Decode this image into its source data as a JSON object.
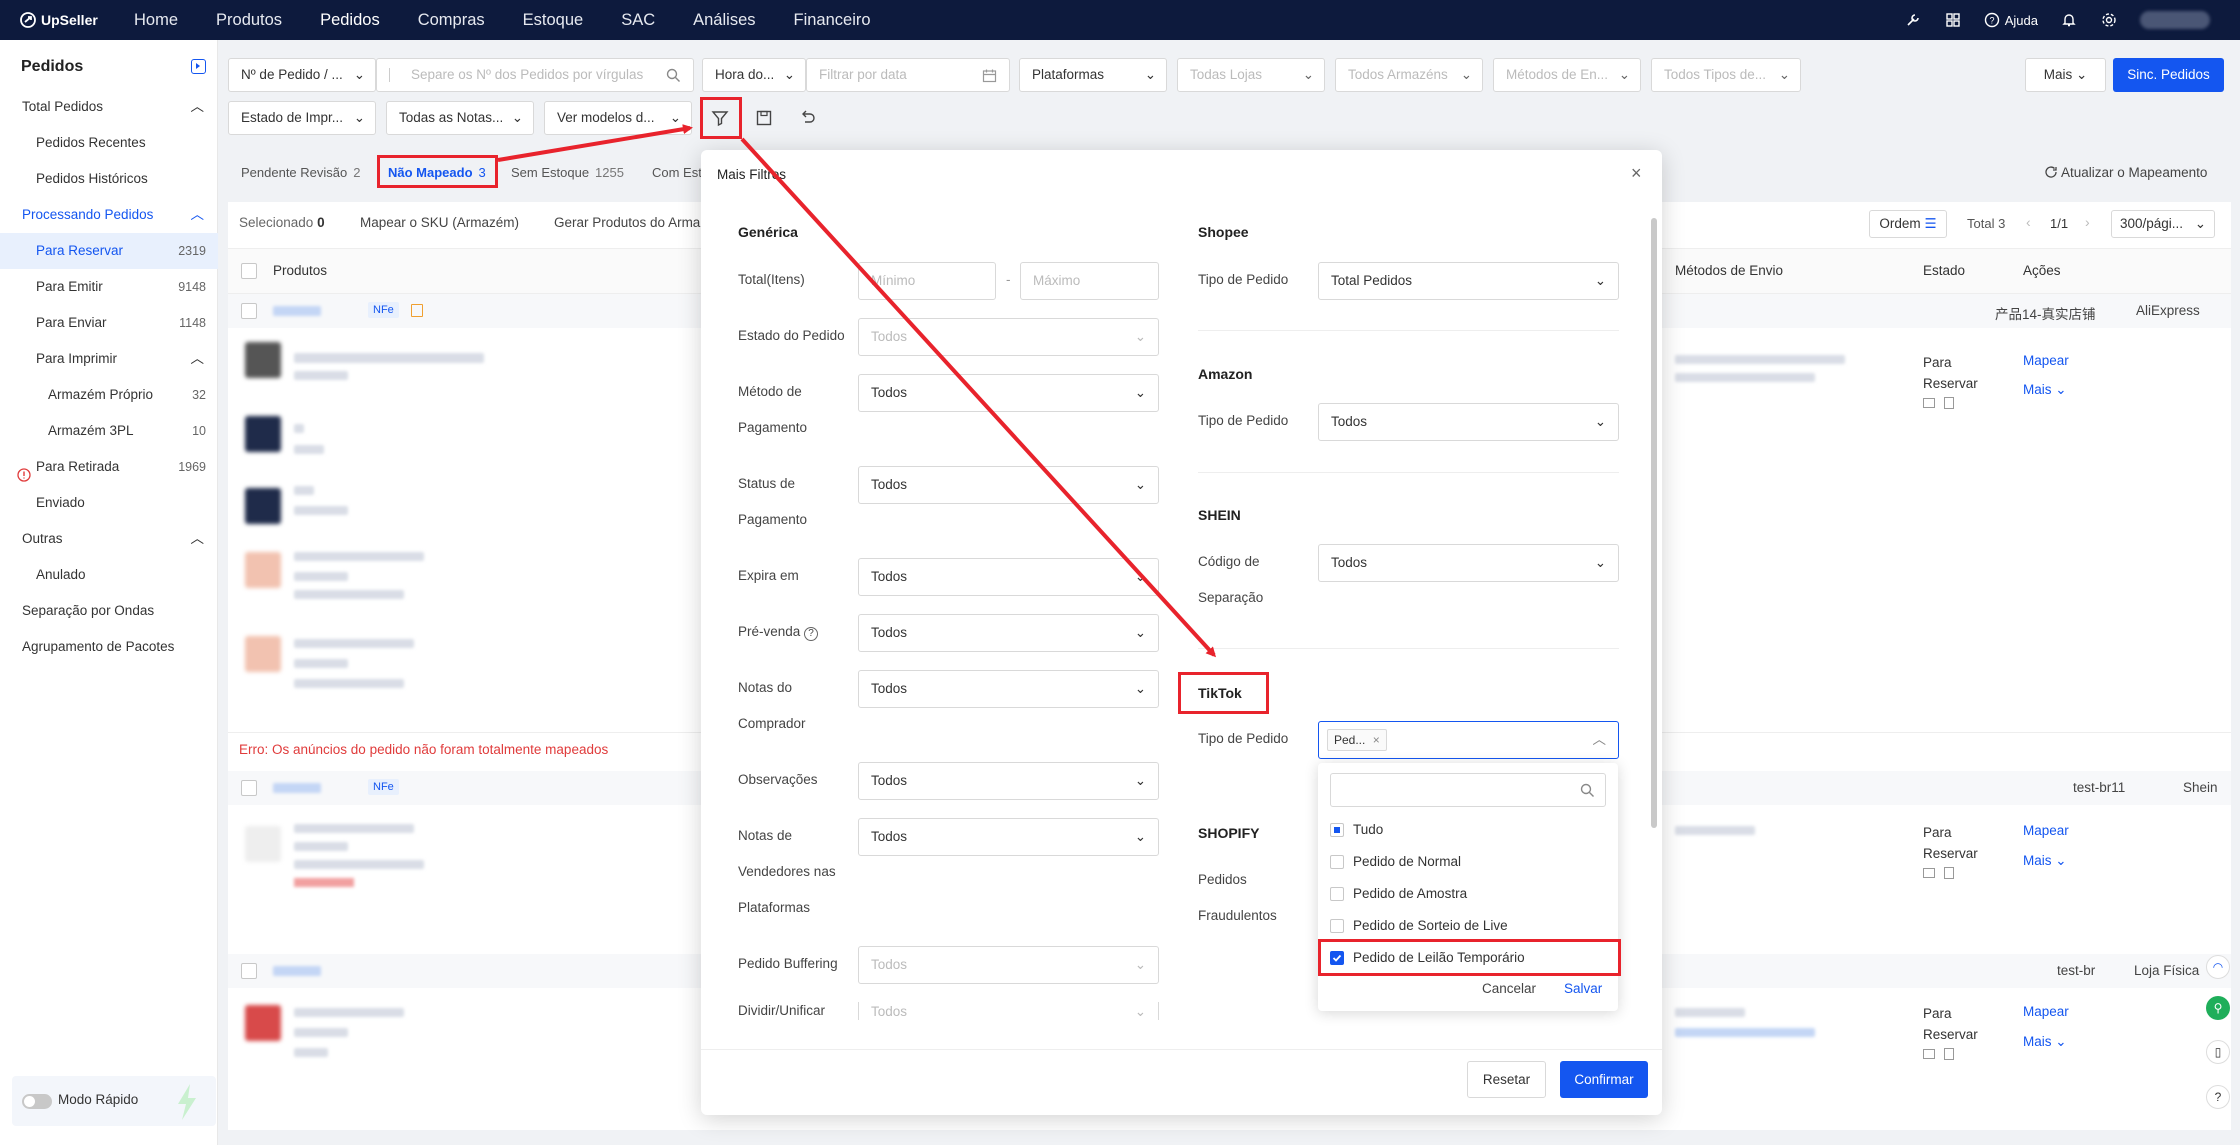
{
  "brand": {
    "name": "UpSeller"
  },
  "nav": {
    "items": [
      "Home",
      "Produtos",
      "Pedidos",
      "Compras",
      "Estoque",
      "SAC",
      "Análises",
      "Financeiro"
    ],
    "active": "Pedidos",
    "help": "Ajuda"
  },
  "sidebar": {
    "title": "Pedidos",
    "items": [
      {
        "label": "Total Pedidos"
      },
      {
        "label": "Pedidos Recentes"
      },
      {
        "label": "Pedidos Históricos"
      },
      {
        "label": "Processando Pedidos"
      },
      {
        "label": "Para Reservar",
        "count": "2319"
      },
      {
        "label": "Para Emitir",
        "count": "9148"
      },
      {
        "label": "Para Enviar",
        "count": "1148"
      },
      {
        "label": "Para Imprimir"
      },
      {
        "label": "Armazém Próprio",
        "count": "32"
      },
      {
        "label": "Armazém 3PL",
        "count": "10"
      },
      {
        "label": "Para Retirada",
        "count": "1969"
      },
      {
        "label": "Enviado"
      },
      {
        "label": "Outras"
      },
      {
        "label": "Anulado"
      },
      {
        "label": "Separação por Ondas"
      },
      {
        "label": "Agrupamento de Pacotes"
      }
    ],
    "quick_mode": "Modo Rápido"
  },
  "filters": {
    "order_no": "Nº de Pedido / ...",
    "search_placeholder": "Separe os Nº dos Pedidos por vírgulas",
    "time": "Hora do...",
    "date_placeholder": "Filtrar por data",
    "platforms": "Plataformas",
    "stores": "Todas Lojas",
    "warehouses": "Todos Armazéns",
    "shipping": "Métodos de En...",
    "types": "Todos Tipos de...",
    "more": "Mais",
    "sync": "Sinc. Pedidos",
    "print_state": "Estado de Impr...",
    "notes": "Todas as Notas...",
    "models": "Ver modelos d..."
  },
  "tabs": [
    {
      "label": "Pendente Revisão",
      "count": "2"
    },
    {
      "label": "Não Mapeado",
      "count": "3"
    },
    {
      "label": "Sem Estoque",
      "count": "1255"
    },
    {
      "label": "Com Est",
      "count": ""
    }
  ],
  "refresh_mapping": "Atualizar o Mapeamento",
  "toolbar": {
    "selected": "Selecionado",
    "selected_count": "0",
    "map_sku": "Mapear o SKU (Armazém)",
    "generate": "Gerar Produtos do Arma",
    "order": "Ordem",
    "total": "Total 3",
    "pages": "1/1",
    "per_page": "300/pági..."
  },
  "table": {
    "headers": {
      "products": "Produtos",
      "shipping": "Métodos de Envio",
      "state": "Estado",
      "actions": "Ações"
    },
    "nfe": "NFe",
    "error": "Erro: Os anúncios do pedido não foram totalmente mapeados",
    "rows": [
      {
        "store": "产品14-真实店铺",
        "platform": "AliExpress",
        "state": "Para Reservar",
        "map": "Mapear",
        "more": "Mais"
      },
      {
        "store": "test-br11",
        "platform": "Shein",
        "state": "Para Reservar",
        "map": "Mapear",
        "more": "Mais"
      },
      {
        "store": "test-br",
        "platform": "Loja Física",
        "state": "Para Reservar",
        "map": "Mapear",
        "more": "Mais"
      }
    ]
  },
  "modal": {
    "title": "Mais Filtros",
    "generic": {
      "title": "Genérica",
      "total_items": "Total(Itens)",
      "min_ph": "Mínimo",
      "max_ph": "Máximo",
      "dash": "-",
      "order_state": "Estado do Pedido",
      "payment_method_1": "Método de",
      "payment_method_2": "Pagamento",
      "payment_status_1": "Status de",
      "payment_status_2": "Pagamento",
      "expires": "Expira em",
      "presale": "Pré-venda",
      "buyer_notes_1": "Notas do",
      "buyer_notes_2": "Comprador",
      "observations": "Observações",
      "seller_notes_1": "Notas de",
      "seller_notes_2": "Vendedores nas",
      "seller_notes_3": "Plataformas",
      "buffering": "Pedido Buffering",
      "split": "Dividir/Unificar",
      "all": "Todos"
    },
    "shopee": {
      "title": "Shopee",
      "type_label": "Tipo de Pedido",
      "value": "Total Pedidos"
    },
    "amazon": {
      "title": "Amazon",
      "type_label": "Tipo de Pedido",
      "value": "Todos"
    },
    "shein": {
      "title": "SHEIN",
      "code_1": "Código de",
      "code_2": "Separação",
      "value": "Todos"
    },
    "tiktok": {
      "title": "TikTok",
      "type_label": "Tipo de Pedido",
      "tag": "Ped..."
    },
    "shopify": {
      "title": "SHOPIFY",
      "fraud_1": "Pedidos",
      "fraud_2": "Fraudulentos"
    },
    "reset": "Resetar",
    "confirm": "Confirmar"
  },
  "dropdown": {
    "options": [
      {
        "label": "Tudo",
        "state": "partial"
      },
      {
        "label": "Pedido de Normal",
        "state": "unchecked"
      },
      {
        "label": "Pedido de Amostra",
        "state": "unchecked"
      },
      {
        "label": "Pedido de Sorteio de Live",
        "state": "unchecked"
      },
      {
        "label": "Pedido de Leilão Temporário",
        "state": "checked"
      }
    ],
    "cancel": "Cancelar",
    "save": "Salvar"
  },
  "colors": {
    "primary": "#1456f0",
    "nav_bg": "#0d1a3d",
    "annotation": "#e8232c",
    "error": "#e03b3b"
  }
}
